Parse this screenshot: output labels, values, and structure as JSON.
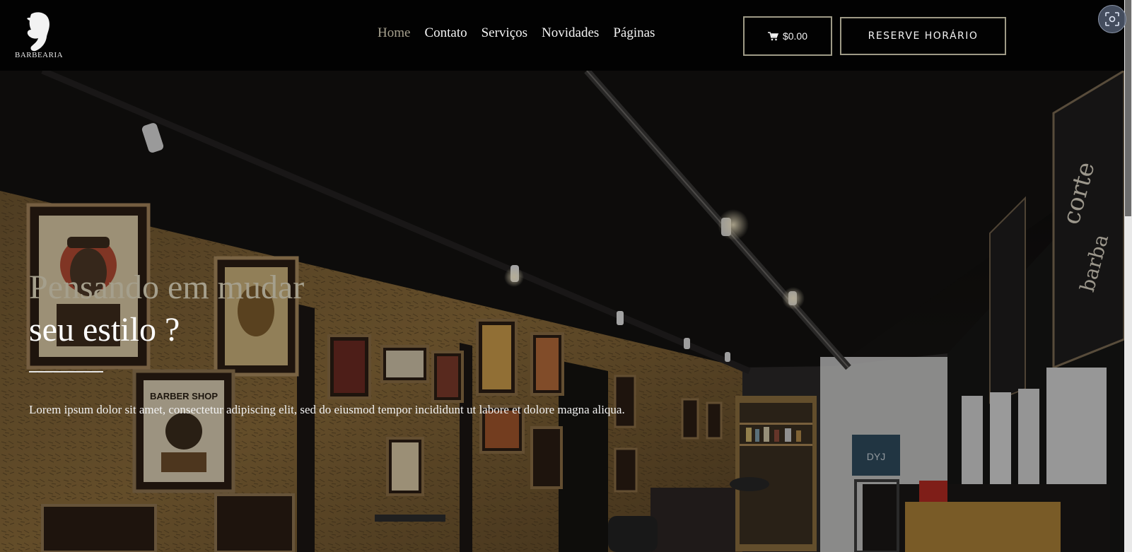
{
  "logo": {
    "text": "BARBEARIA"
  },
  "nav": {
    "items": [
      {
        "label": "Home",
        "active": true
      },
      {
        "label": "Contato",
        "active": false
      },
      {
        "label": "Serviços",
        "active": false
      },
      {
        "label": "Novidades",
        "active": false
      },
      {
        "label": "Páginas",
        "active": false
      }
    ]
  },
  "cart": {
    "amount": "$0.00",
    "icon": "cart-icon"
  },
  "reserve": {
    "label": "RESERVE HORÁRIO"
  },
  "hero": {
    "headline_line1": "Pensando em mudar",
    "headline_line2": "seu estilo ?",
    "lead": "Lorem ipsum dolor sit amet, consectetur adipiscing elit, sed do eiusmod tempor incididunt ut labore et dolore magna aliqua.",
    "sign_lettering": "BARBER SHOP"
  },
  "colors": {
    "accent": "#a6a08e",
    "header_bg": "#020202",
    "button_border": "#9e9a86"
  }
}
